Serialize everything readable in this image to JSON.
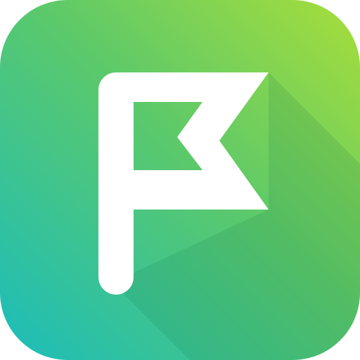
{
  "icon": {
    "name": "flag-icon",
    "gradient": {
      "top_right": "#A8DE3A",
      "middle": "#5CC96A",
      "bottom_left": "#1BBDBC"
    },
    "glyph_color": "#FFFFFF",
    "shadow_color": "#0E6E4A"
  }
}
